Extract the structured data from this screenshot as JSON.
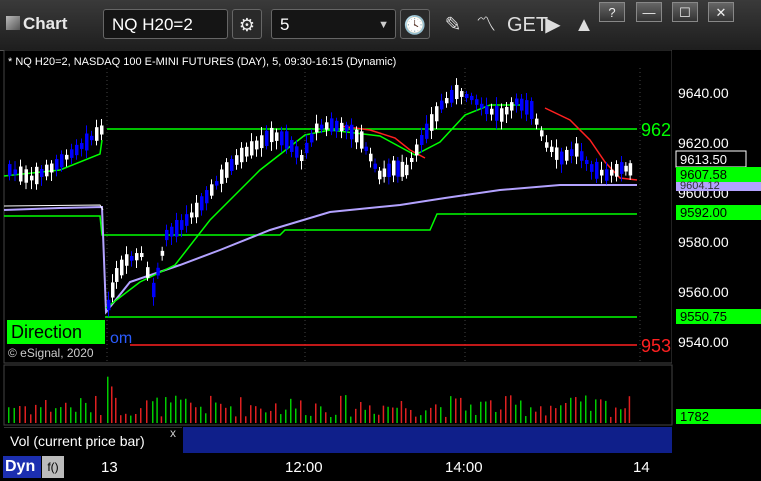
{
  "toolbar": {
    "title": "Chart",
    "symbol": "NQ H20=2",
    "interval": "5",
    "window_buttons": [
      "?",
      "—",
      "☐",
      "✕"
    ]
  },
  "chart": {
    "header": "* NQ H20=2, NASDAQ 100 E-MINI FUTURES (DAY), 5, 09:30-16:15 (Dynamic)",
    "price_axis": [
      "9640.00",
      "9620.00",
      "9600.00",
      "9580.00",
      "9560.00",
      "9540.00"
    ],
    "price_tags": {
      "last": "9613.50",
      "ma_fast": "9607.58",
      "ma_slow": "9604.12",
      "level_9592": "9592.00",
      "level_9550": "9550.75",
      "level_962x": "962",
      "level_953x": "953"
    },
    "direction_label": "Direction",
    "blue_fragment": "om",
    "copyright": "© eSignal, 2020",
    "volume_value": "1782",
    "volume_label": "Vol (current price bar)",
    "volume_close": "x",
    "bottom_mode": "Dyn",
    "bottom_fx": "f()",
    "time_axis": [
      "13",
      "12:00",
      "14:00",
      "14"
    ]
  },
  "colors": {
    "up": "#0000ff",
    "down": "#ffffff",
    "green": "#00ff00",
    "red": "#ff2020",
    "purple": "#b3a2ff"
  }
}
